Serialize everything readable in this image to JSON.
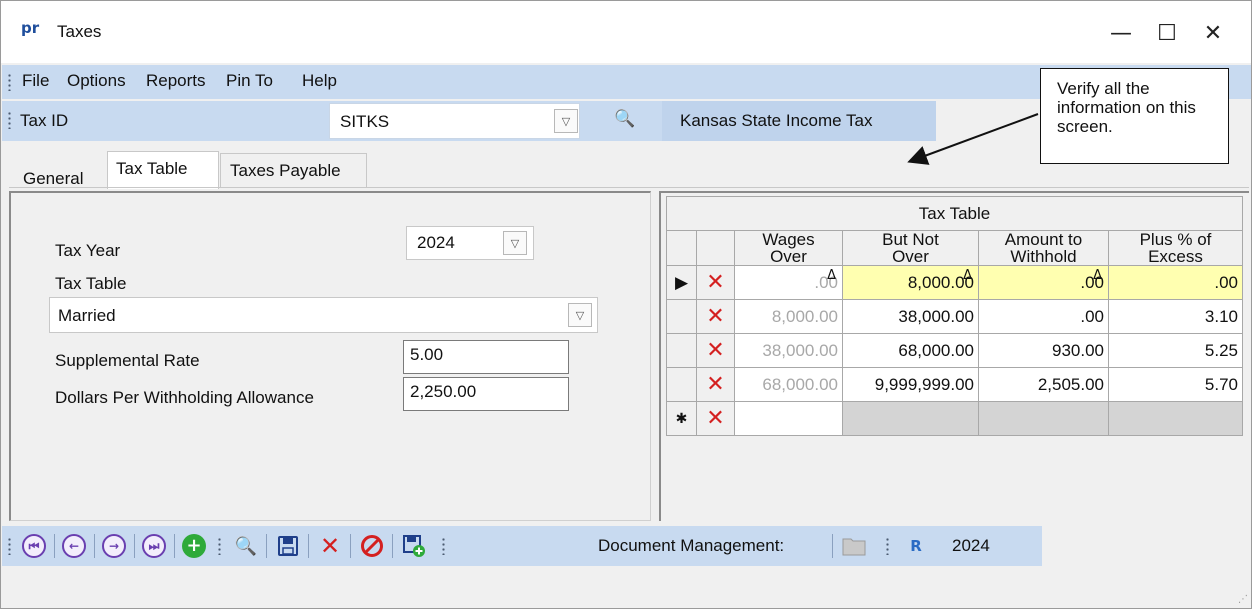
{
  "window": {
    "app_icon": "pr",
    "title": "Taxes",
    "minimize_glyph": "—",
    "maximize_glyph": "☐",
    "close_glyph": "✕"
  },
  "menu": [
    "File",
    "Options",
    "Reports",
    "Pin To",
    "Help"
  ],
  "tax_id": {
    "label": "Tax ID",
    "value": "SITKS",
    "description": "Kansas State Income Tax"
  },
  "callout": "Verify all the information on this screen.",
  "tabs": [
    "General",
    "Tax Table",
    "Taxes Payable"
  ],
  "active_tab": "Tax Table",
  "form": {
    "tax_year_label": "Tax Year",
    "tax_year_value": "2024",
    "tax_table_label": "Tax Table",
    "tax_table_value": "Married",
    "supplemental_rate_label": "Supplemental Rate",
    "supplemental_rate_value": "5.00",
    "dollars_per_allowance_label": "Dollars Per Withholding Allowance",
    "dollars_per_allowance_value": "2,250.00"
  },
  "grid": {
    "title": "Tax Table",
    "sort_glyph": "Δ",
    "columns": [
      {
        "line1": "Wages",
        "line2": "Over",
        "sortable": true
      },
      {
        "line1": "But Not",
        "line2": "Over",
        "sortable": true
      },
      {
        "line1": "Amount to",
        "line2": "Withhold",
        "sortable": true
      },
      {
        "line1": "Plus % of",
        "line2": "Excess",
        "sortable": false
      }
    ],
    "rows": [
      {
        "wages_over": ".00",
        "but_not_over": "8,000.00",
        "amount_to_withhold": ".00",
        "plus_pct_excess": ".00"
      },
      {
        "wages_over": "8,000.00",
        "but_not_over": "38,000.00",
        "amount_to_withhold": ".00",
        "plus_pct_excess": "3.10"
      },
      {
        "wages_over": "38,000.00",
        "but_not_over": "68,000.00",
        "amount_to_withhold": "930.00",
        "plus_pct_excess": "5.25"
      },
      {
        "wages_over": "68,000.00",
        "but_not_over": "9,999,999.00",
        "amount_to_withhold": "2,505.00",
        "plus_pct_excess": "5.70"
      }
    ],
    "current_row_glyph": "▶",
    "new_row_glyph": "✱",
    "delete_glyph": "✕"
  },
  "toolbar": {
    "icons": [
      "first-record-icon",
      "previous-record-icon",
      "next-record-icon",
      "last-record-icon",
      "add-record-icon",
      "find-icon",
      "save-icon",
      "delete-icon",
      "cancel-icon",
      "save-and-new-icon",
      "folder-icon",
      "report-icon"
    ],
    "document_management_label": "Document Management:",
    "year": "2024"
  },
  "colors": {
    "menubar": "#c8daf0",
    "highlight_row": "#ffffb0",
    "delete_red": "#d42020",
    "nav_purple": "#6a3fb0",
    "add_green": "#2eaa3a"
  }
}
